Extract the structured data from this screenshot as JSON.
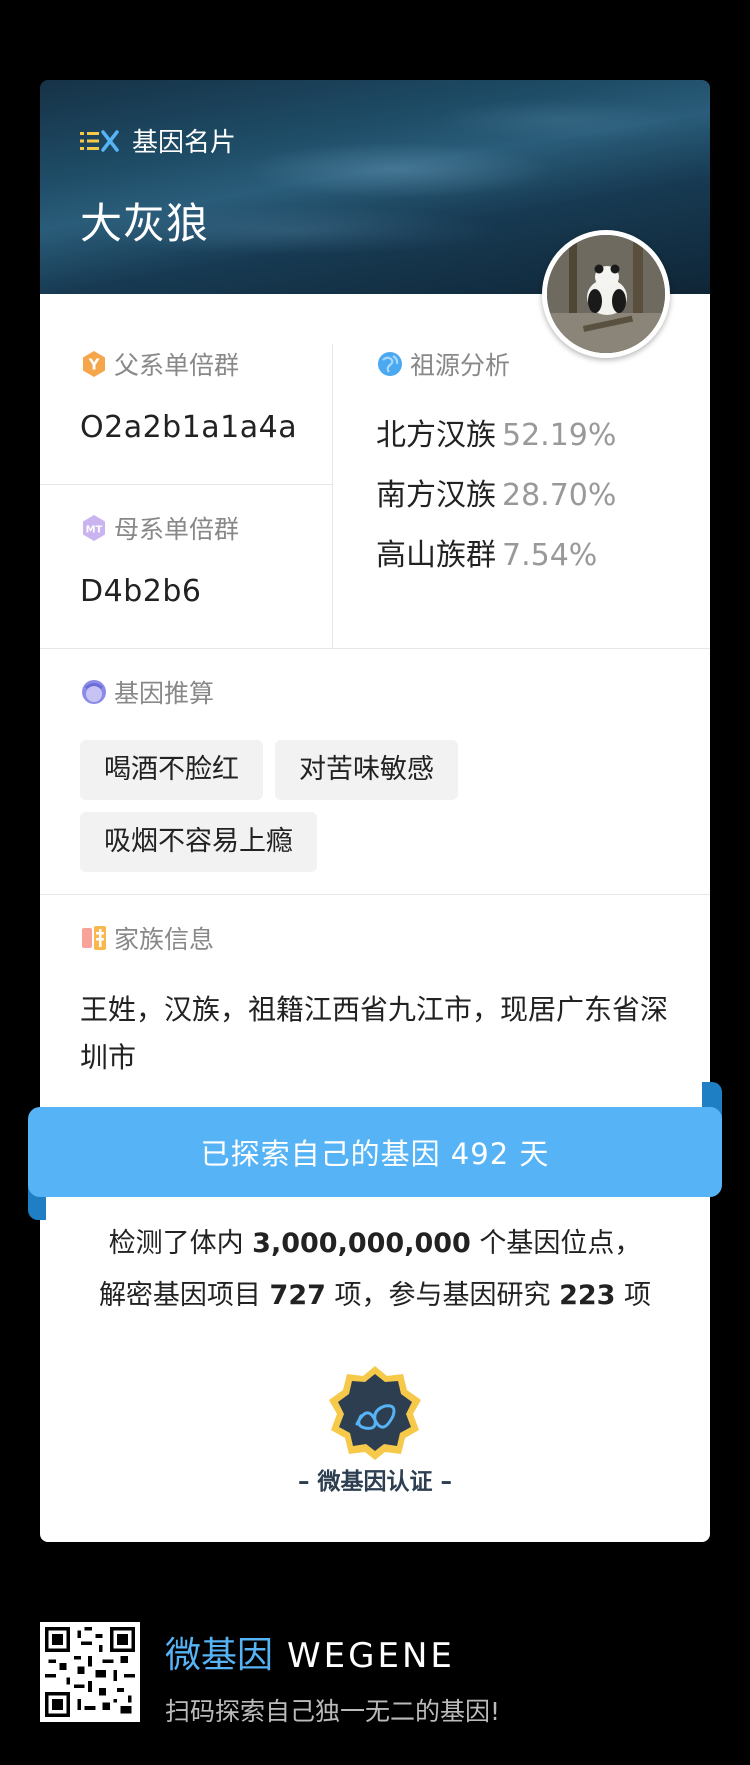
{
  "header": {
    "brand_label": "基因名片",
    "user_name": "大灰狼"
  },
  "paternal": {
    "title": "父系单倍群",
    "value": "O2a2b1a1a4a"
  },
  "maternal": {
    "title": "母系单倍群",
    "value": "D4b2b6"
  },
  "ancestry": {
    "title": "祖源分析",
    "items": [
      {
        "name": "北方汉族",
        "percent": "52.19%"
      },
      {
        "name": "南方汉族",
        "percent": "28.70%"
      },
      {
        "name": "高山族群",
        "percent": "7.54%"
      }
    ]
  },
  "traits": {
    "title": "基因推算",
    "tags": [
      "喝酒不脸红",
      "对苦味敏感",
      "吸烟不容易上瘾"
    ]
  },
  "family": {
    "title": "家族信息",
    "text": "王姓，汉族，祖籍江西省九江市，现居广东省深圳市"
  },
  "ribbon": {
    "text": "已探索自己的基因 492 天"
  },
  "stats": {
    "line1_prefix": "检测了体内 ",
    "sites": "3,000,000,000",
    "line1_suffix": " 个基因位点，",
    "line2_prefix": "解密基因项目 ",
    "projects": "727",
    "line2_mid": " 项，参与基因研究 ",
    "studies": "223",
    "line2_suffix": " 项"
  },
  "certification": {
    "label": "– 微基因认证 –"
  },
  "footer": {
    "brand_cn": "微基因",
    "brand_en": "WEGENE",
    "slogan": "扫码探索自己独一无二的基因!"
  },
  "colors": {
    "accent": "#56b4f6",
    "ribbon_dark": "#1e7fc4",
    "badge_gold": "#f6c94a",
    "badge_dark": "#2c3e50"
  }
}
